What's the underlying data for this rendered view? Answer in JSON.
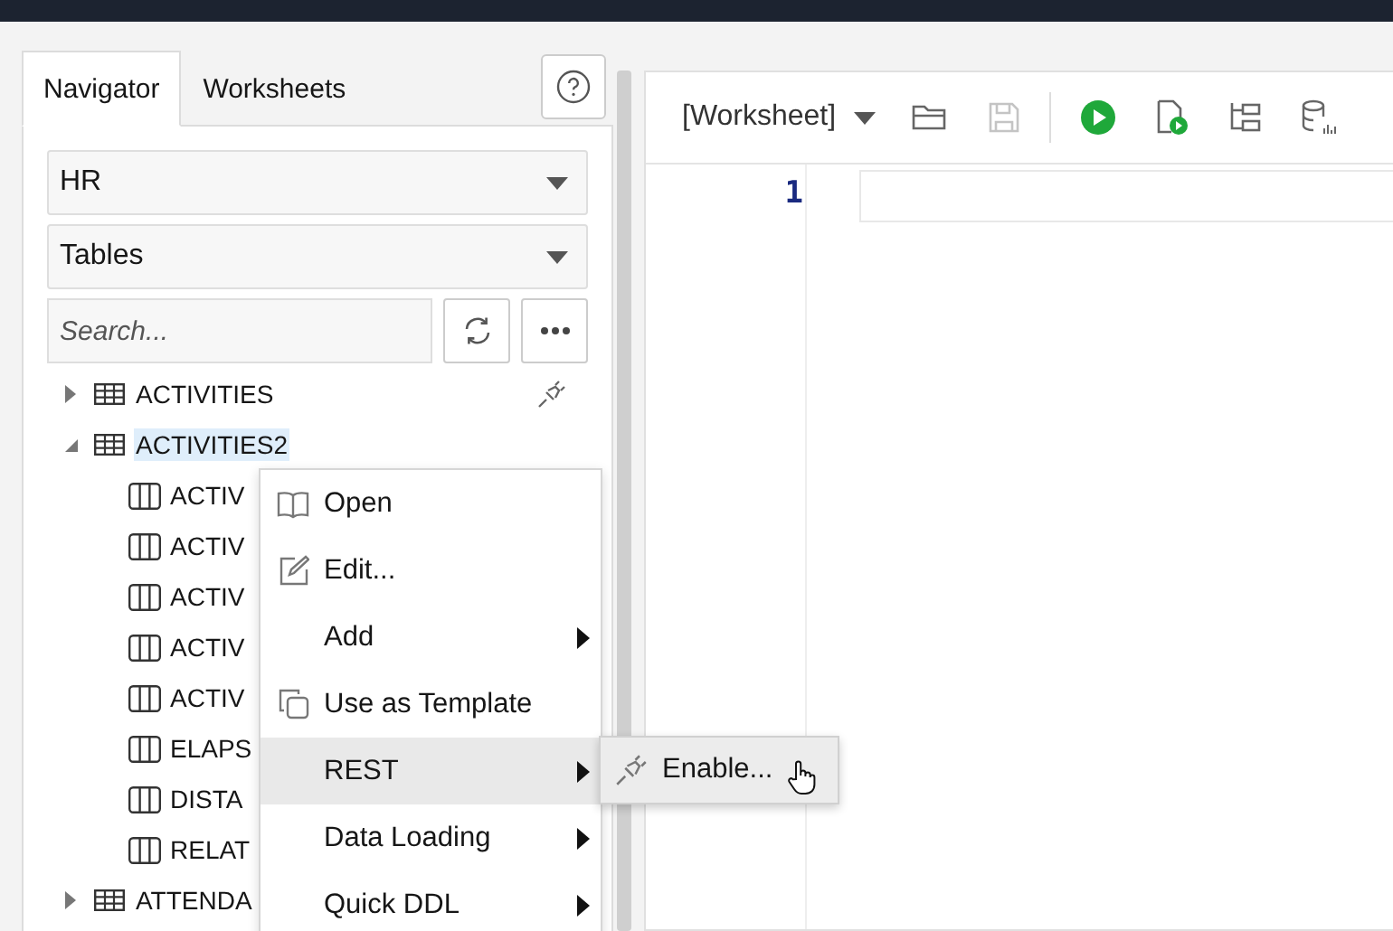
{
  "navigator": {
    "tabs": [
      {
        "label": "Navigator",
        "selected": true
      },
      {
        "label": "Worksheets",
        "selected": false
      }
    ],
    "schema": "HR",
    "object_type": "Tables",
    "search": {
      "placeholder": "Search..."
    },
    "tree": [
      {
        "label": "ACTIVITIES",
        "kind": "table",
        "expanded": false,
        "selected": false,
        "rest_enabled": true
      },
      {
        "label": "ACTIVITIES2",
        "kind": "table",
        "expanded": true,
        "selected": true,
        "rest_enabled": false,
        "children": [
          {
            "label": "ACTIV",
            "kind": "column"
          },
          {
            "label": "ACTIV",
            "kind": "column"
          },
          {
            "label": "ACTIV",
            "kind": "column"
          },
          {
            "label": "ACTIV",
            "kind": "column"
          },
          {
            "label": "ACTIV",
            "kind": "column"
          },
          {
            "label": "ELAPS",
            "kind": "column"
          },
          {
            "label": "DISTA",
            "kind": "column"
          },
          {
            "label": "RELAT",
            "kind": "column"
          }
        ]
      },
      {
        "label": "ATTENDA",
        "kind": "table",
        "expanded": false,
        "selected": false,
        "rest_enabled": false
      }
    ]
  },
  "worksheet": {
    "name": "[Worksheet]",
    "line_numbers": [
      "1"
    ]
  },
  "context_menu": {
    "items": [
      {
        "label": "Open",
        "submenu": false,
        "highlighted": false
      },
      {
        "label": "Edit...",
        "submenu": false,
        "highlighted": false
      },
      {
        "label": "Add",
        "submenu": true,
        "highlighted": false
      },
      {
        "label": "Use as Template",
        "submenu": false,
        "highlighted": false
      },
      {
        "label": "REST",
        "submenu": true,
        "highlighted": true
      },
      {
        "label": "Data Loading",
        "submenu": true,
        "highlighted": false
      },
      {
        "label": "Quick DDL",
        "submenu": true,
        "highlighted": false
      }
    ]
  },
  "submenu": {
    "items": [
      {
        "label": "Enable...",
        "hovered": true
      }
    ]
  }
}
